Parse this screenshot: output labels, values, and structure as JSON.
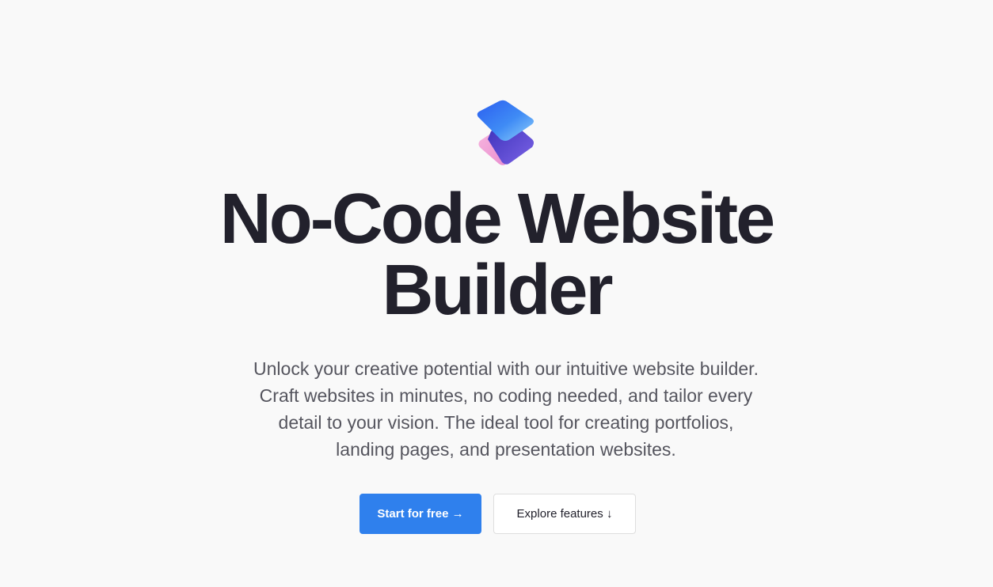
{
  "hero": {
    "title_line1": "No-Code Website",
    "title_line2": "Builder",
    "description": "Unlock your creative potential with our intuitive website builder. Craft websites in minutes, no coding needed, and tailor every detail to your vision. The ideal tool for creating portfolios, landing pages, and presentation websites."
  },
  "actions": {
    "primary_label": "Start for free →",
    "secondary_label": "Explore features ↓"
  },
  "logo": {
    "icon": "stacked-diamond-logo-icon"
  },
  "colors": {
    "background": "#f9f9f9",
    "heading": "#22212c",
    "body_text": "#55555e",
    "primary_button": "#2f80ed",
    "logo_blue": "#2b6cf0",
    "logo_purple": "#5b3fc9",
    "logo_pink": "#f4a6d7"
  }
}
